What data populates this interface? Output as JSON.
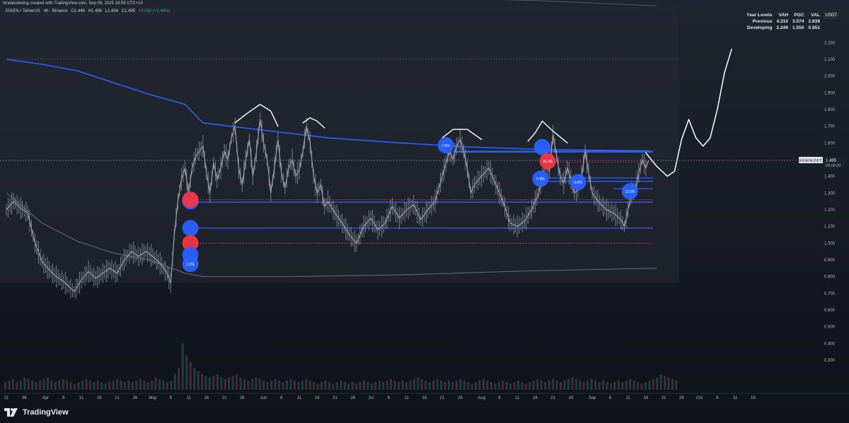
{
  "header": {
    "credit": "timelessbeing created with TradingView.com, Sep 09, 2025 18:59 UTC+10",
    "symbol": "EIGEN / TetherUS · 4h · Binance",
    "ohlc": {
      "open": "O1.446",
      "high": "H1.496",
      "low": "L1.434",
      "close": "C1.495",
      "change": "+0.050 (+3.46%)"
    }
  },
  "currency_button": "USDT",
  "year_levels": {
    "headers": [
      "Year Levels",
      "VAH",
      "POC",
      "VAL"
    ],
    "rows": [
      [
        "Previous",
        "4.310",
        "3.574",
        "2.838"
      ],
      [
        "Developing",
        "2.249",
        "1.550",
        "0.851"
      ]
    ]
  },
  "brand": "TradingView",
  "colors": {
    "background": "#131722",
    "grid": "#2a2e39",
    "vwap": "#2962ff",
    "price": "#b7bac2",
    "buy_marker": "#2962ff",
    "sell_marker": "#f23645"
  },
  "chart_data": {
    "type": "line",
    "symbol": "EIGENUSDT",
    "timeframe": "4h",
    "y_scale": "linear",
    "ylim": [
      0.25,
      2.25
    ],
    "y_ticks": [
      "2.200",
      "2.100",
      "2.000",
      "1.900",
      "1.800",
      "1.700",
      "1.600",
      "1.500",
      "1.400",
      "1.300",
      "1.200",
      "1.100",
      "1.000",
      "0.900",
      "0.800",
      "0.700",
      "0.600",
      "0.500",
      "0.400",
      "0.300"
    ],
    "y_tick_values": [
      2.2,
      2.1,
      2.0,
      1.9,
      1.8,
      1.7,
      1.6,
      1.5,
      1.4,
      1.3,
      1.2,
      1.1,
      1.0,
      0.9,
      0.8,
      0.7,
      0.6,
      0.5,
      0.4,
      0.3
    ],
    "xlim": [
      0,
      234
    ],
    "x_ticks": [
      {
        "label": "21",
        "d": 0
      },
      {
        "label": "26",
        "d": 5
      },
      {
        "label": "Apr",
        "d": 11
      },
      {
        "label": "6",
        "d": 16
      },
      {
        "label": "11",
        "d": 21
      },
      {
        "label": "16",
        "d": 26
      },
      {
        "label": "21",
        "d": 31
      },
      {
        "label": "26",
        "d": 36
      },
      {
        "label": "May",
        "d": 41
      },
      {
        "label": "6",
        "d": 46
      },
      {
        "label": "11",
        "d": 51
      },
      {
        "label": "16",
        "d": 56
      },
      {
        "label": "21",
        "d": 61
      },
      {
        "label": "26",
        "d": 66
      },
      {
        "label": "Jun",
        "d": 72
      },
      {
        "label": "6",
        "d": 77
      },
      {
        "label": "11",
        "d": 82
      },
      {
        "label": "16",
        "d": 87
      },
      {
        "label": "21",
        "d": 92
      },
      {
        "label": "26",
        "d": 97
      },
      {
        "label": "Jul",
        "d": 102
      },
      {
        "label": "6",
        "d": 107
      },
      {
        "label": "11",
        "d": 112
      },
      {
        "label": "16",
        "d": 117
      },
      {
        "label": "21",
        "d": 122
      },
      {
        "label": "26",
        "d": 127
      },
      {
        "label": "Aug",
        "d": 133
      },
      {
        "label": "6",
        "d": 138
      },
      {
        "label": "11",
        "d": 143
      },
      {
        "label": "16",
        "d": 148
      },
      {
        "label": "21",
        "d": 153
      },
      {
        "label": "26",
        "d": 158
      },
      {
        "label": "Sep",
        "d": 164
      },
      {
        "label": "6",
        "d": 169
      },
      {
        "label": "11",
        "d": 174
      },
      {
        "label": "16",
        "d": 179
      },
      {
        "label": "21",
        "d": 184
      },
      {
        "label": "26",
        "d": 189
      },
      {
        "label": "Oct",
        "d": 194
      },
      {
        "label": "6",
        "d": 199
      },
      {
        "label": "11",
        "d": 204
      },
      {
        "label": "16",
        "d": 209
      }
    ],
    "price": {
      "name": "EIGENUSDT",
      "points": [
        [
          0,
          1.2
        ],
        [
          2,
          1.25
        ],
        [
          4,
          1.21
        ],
        [
          6,
          1.18
        ],
        [
          8,
          1.0
        ],
        [
          10,
          0.89
        ],
        [
          12,
          0.84
        ],
        [
          14,
          0.8
        ],
        [
          16,
          0.77
        ],
        [
          18,
          0.73
        ],
        [
          19,
          0.71
        ],
        [
          21,
          0.78
        ],
        [
          23,
          0.83
        ],
        [
          25,
          0.79
        ],
        [
          27,
          0.82
        ],
        [
          29,
          0.85
        ],
        [
          31,
          0.82
        ],
        [
          33,
          0.9
        ],
        [
          35,
          0.95
        ],
        [
          37,
          0.92
        ],
        [
          39,
          0.95
        ],
        [
          41,
          0.92
        ],
        [
          43,
          0.88
        ],
        [
          45,
          0.82
        ],
        [
          46,
          0.76
        ],
        [
          47,
          1.05
        ],
        [
          48,
          1.25
        ],
        [
          49,
          1.38
        ],
        [
          50,
          1.45
        ],
        [
          51,
          1.3
        ],
        [
          52,
          1.45
        ],
        [
          53,
          1.52
        ],
        [
          55,
          1.58
        ],
        [
          56,
          1.42
        ],
        [
          57,
          1.3
        ],
        [
          58,
          1.48
        ],
        [
          59,
          1.38
        ],
        [
          60,
          1.45
        ],
        [
          61,
          1.55
        ],
        [
          62,
          1.5
        ],
        [
          63,
          1.63
        ],
        [
          64,
          1.7
        ],
        [
          65,
          1.45
        ],
        [
          66,
          1.35
        ],
        [
          67,
          1.5
        ],
        [
          68,
          1.62
        ],
        [
          69,
          1.4
        ],
        [
          70,
          1.55
        ],
        [
          71,
          1.74
        ],
        [
          72,
          1.6
        ],
        [
          73,
          1.5
        ],
        [
          74,
          1.3
        ],
        [
          75,
          1.45
        ],
        [
          76,
          1.62
        ],
        [
          77,
          1.42
        ],
        [
          78,
          1.33
        ],
        [
          79,
          1.45
        ],
        [
          80,
          1.5
        ],
        [
          81,
          1.4
        ],
        [
          82,
          1.44
        ],
        [
          83,
          1.55
        ],
        [
          84,
          1.7
        ],
        [
          85,
          1.6
        ],
        [
          86,
          1.4
        ],
        [
          87,
          1.3
        ],
        [
          88,
          1.35
        ],
        [
          89,
          1.22
        ],
        [
          90,
          1.25
        ],
        [
          92,
          1.18
        ],
        [
          94,
          1.12
        ],
        [
          96,
          1.05
        ],
        [
          98,
          1.0
        ],
        [
          100,
          1.1
        ],
        [
          102,
          1.15
        ],
        [
          104,
          1.08
        ],
        [
          106,
          1.12
        ],
        [
          108,
          1.22
        ],
        [
          110,
          1.15
        ],
        [
          112,
          1.2
        ],
        [
          114,
          1.23
        ],
        [
          116,
          1.14
        ],
        [
          118,
          1.2
        ],
        [
          120,
          1.25
        ],
        [
          122,
          1.4
        ],
        [
          124,
          1.55
        ],
        [
          125,
          1.5
        ],
        [
          126,
          1.58
        ],
        [
          127,
          1.62
        ],
        [
          128,
          1.55
        ],
        [
          129,
          1.45
        ],
        [
          130,
          1.3
        ],
        [
          131,
          1.35
        ],
        [
          133,
          1.4
        ],
        [
          135,
          1.45
        ],
        [
          137,
          1.35
        ],
        [
          139,
          1.25
        ],
        [
          141,
          1.12
        ],
        [
          143,
          1.1
        ],
        [
          145,
          1.13
        ],
        [
          147,
          1.2
        ],
        [
          149,
          1.3
        ],
        [
          150,
          1.4
        ],
        [
          151,
          1.48
        ],
        [
          152,
          1.43
        ],
        [
          153,
          1.65
        ],
        [
          154,
          1.52
        ],
        [
          155,
          1.4
        ],
        [
          156,
          1.36
        ],
        [
          157,
          1.45
        ],
        [
          158,
          1.38
        ],
        [
          159,
          1.3
        ],
        [
          160,
          1.32
        ],
        [
          161,
          1.4
        ],
        [
          162,
          1.55
        ],
        [
          163,
          1.42
        ],
        [
          164,
          1.3
        ],
        [
          166,
          1.24
        ],
        [
          168,
          1.2
        ],
        [
          170,
          1.18
        ],
        [
          172,
          1.14
        ],
        [
          173,
          1.1
        ],
        [
          174,
          1.2
        ],
        [
          175,
          1.3
        ],
        [
          176,
          1.32
        ],
        [
          177,
          1.42
        ],
        [
          178,
          1.5
        ],
        [
          179,
          1.45
        ],
        [
          179.7,
          1.495
        ]
      ]
    },
    "vwap_upper_band": {
      "points": [
        [
          0,
          2.55
        ],
        [
          50,
          2.52
        ],
        [
          100,
          2.48
        ],
        [
          150,
          2.45
        ],
        [
          182,
          2.42
        ]
      ]
    },
    "vwap_main": {
      "points": [
        [
          0,
          2.1
        ],
        [
          10,
          2.07
        ],
        [
          20,
          2.03
        ],
        [
          30,
          1.96
        ],
        [
          40,
          1.89
        ],
        [
          50,
          1.83
        ],
        [
          55,
          1.72
        ],
        [
          70,
          1.68
        ],
        [
          90,
          1.63
        ],
        [
          110,
          1.6
        ],
        [
          130,
          1.575
        ],
        [
          150,
          1.56
        ],
        [
          180,
          1.552
        ]
      ]
    },
    "vwap_lower_band": {
      "points": [
        [
          0,
          1.3
        ],
        [
          10,
          1.12
        ],
        [
          20,
          1.01
        ],
        [
          30,
          0.94
        ],
        [
          40,
          0.9
        ],
        [
          50,
          0.82
        ],
        [
          55,
          0.8
        ],
        [
          80,
          0.8
        ],
        [
          110,
          0.81
        ],
        [
          140,
          0.83
        ],
        [
          170,
          0.845
        ],
        [
          182,
          0.85
        ]
      ]
    },
    "horizontal_levels": [
      {
        "name": "resistance-1",
        "y": 1.55,
        "x1": 125,
        "x2": 181,
        "style": "solid"
      },
      {
        "name": "resistance-2",
        "y": 1.545,
        "x1": 125,
        "x2": 181,
        "style": "solid"
      },
      {
        "name": "res-box-top",
        "y": 1.39,
        "x1": 149,
        "x2": 181,
        "style": "solid"
      },
      {
        "name": "res-box-mid",
        "y": 1.37,
        "x1": 149,
        "x2": 181,
        "style": "solid"
      },
      {
        "name": "res-box-low",
        "y": 1.325,
        "x1": 170,
        "x2": 181,
        "style": "solid"
      },
      {
        "name": "support-1",
        "y": 1.245,
        "x1": 51,
        "x2": 181,
        "style": "solid"
      },
      {
        "name": "support-2",
        "y": 1.09,
        "x1": 51,
        "x2": 181,
        "style": "solid"
      },
      {
        "name": "red-dotted-1",
        "y": 1.485,
        "x1": 151,
        "x2": 181,
        "style": "dotted"
      },
      {
        "name": "red-dotted-2",
        "y": 1.26,
        "x1": 51,
        "x2": 181,
        "style": "dotted"
      },
      {
        "name": "red-dotted-3",
        "y": 1.0,
        "x1": 51,
        "x2": 181,
        "style": "dotted"
      },
      {
        "name": "gray-dotted-2100",
        "y": 2.1,
        "x1": 0,
        "x2": 182,
        "style": "dotted"
      }
    ],
    "last_price": {
      "label": "EIGENUSDT",
      "value": "1.495",
      "countdown": "03:00:20",
      "y": 1.495
    },
    "markers": [
      {
        "x": 51.5,
        "y": 1.25,
        "color": "blue",
        "label": ""
      },
      {
        "x": 51.5,
        "y": 1.26,
        "color": "red",
        "label": ""
      },
      {
        "x": 51.5,
        "y": 1.09,
        "color": "blue",
        "label": ""
      },
      {
        "x": 51.5,
        "y": 1.0,
        "color": "red",
        "label": ""
      },
      {
        "x": 51.5,
        "y": 0.93,
        "color": "blue",
        "label": ""
      },
      {
        "x": 51.5,
        "y": 0.875,
        "color": "blue",
        "label": "3.3%"
      },
      {
        "x": 123,
        "y": 1.585,
        "color": "blue",
        "label": "7.6%"
      },
      {
        "x": 150,
        "y": 1.575,
        "color": "blue",
        "label": ""
      },
      {
        "x": 151.5,
        "y": 1.49,
        "color": "red",
        "label": "30.0%"
      },
      {
        "x": 149.5,
        "y": 1.385,
        "color": "blue",
        "label": "5.3%"
      },
      {
        "x": 160,
        "y": 1.365,
        "color": "blue",
        "label": "9.6%"
      },
      {
        "x": 174.5,
        "y": 1.31,
        "color": "blue",
        "label": "12.5%"
      }
    ],
    "sketch_arches": [
      [
        [
          64,
          1.72
        ],
        [
          67,
          1.77
        ],
        [
          71,
          1.83
        ],
        [
          74,
          1.79
        ],
        [
          76,
          1.7
        ]
      ],
      [
        [
          83,
          1.72
        ],
        [
          85,
          1.75
        ],
        [
          87,
          1.73
        ],
        [
          89,
          1.69
        ]
      ],
      [
        [
          122,
          1.63
        ],
        [
          125,
          1.68
        ],
        [
          129,
          1.68
        ],
        [
          133,
          1.62
        ]
      ],
      [
        [
          146,
          1.61
        ],
        [
          148,
          1.66
        ],
        [
          150,
          1.73
        ],
        [
          153,
          1.67
        ],
        [
          157,
          1.6
        ]
      ]
    ],
    "projection_path": [
      [
        179,
        1.54
      ],
      [
        182,
        1.46
      ],
      [
        185,
        1.4
      ],
      [
        187,
        1.43
      ],
      [
        189,
        1.62
      ],
      [
        191,
        1.74
      ],
      [
        193,
        1.63
      ],
      [
        195,
        1.58
      ],
      [
        197,
        1.63
      ],
      [
        199,
        1.8
      ],
      [
        201,
        2.02
      ],
      [
        203,
        2.16
      ]
    ],
    "volume": {
      "name": "Volume",
      "values": [
        0.05,
        0.06,
        0.07,
        0.05,
        0.06,
        0.08,
        0.07,
        0.06,
        0.05,
        0.06,
        0.07,
        0.08,
        0.06,
        0.05,
        0.06,
        0.07,
        0.06,
        0.05,
        0.04,
        0.05,
        0.06,
        0.07,
        0.06,
        0.05,
        0.06,
        0.05,
        0.04,
        0.05,
        0.06,
        0.07,
        0.06,
        0.05,
        0.06,
        0.05,
        0.06,
        0.07,
        0.06,
        0.05,
        0.06,
        0.08,
        0.07,
        0.06,
        0.05,
        0.06,
        0.1,
        0.14,
        0.3,
        0.22,
        0.18,
        0.14,
        0.12,
        0.1,
        0.09,
        0.08,
        0.09,
        0.1,
        0.08,
        0.07,
        0.08,
        0.09,
        0.1,
        0.08,
        0.07,
        0.06,
        0.07,
        0.08,
        0.07,
        0.06,
        0.05,
        0.06,
        0.07,
        0.06,
        0.05,
        0.06,
        0.07,
        0.06,
        0.05,
        0.06,
        0.07,
        0.06,
        0.05,
        0.04,
        0.05,
        0.06,
        0.05,
        0.04,
        0.05,
        0.06,
        0.05,
        0.04,
        0.05,
        0.04,
        0.05,
        0.06,
        0.05,
        0.04,
        0.05,
        0.06,
        0.05,
        0.06,
        0.07,
        0.06,
        0.05,
        0.06,
        0.05,
        0.06,
        0.07,
        0.08,
        0.07,
        0.06,
        0.05,
        0.06,
        0.07,
        0.06,
        0.05,
        0.06,
        0.05,
        0.06,
        0.07,
        0.06,
        0.05,
        0.04,
        0.05,
        0.06,
        0.07,
        0.06,
        0.05,
        0.04,
        0.05,
        0.06,
        0.05,
        0.04,
        0.05,
        0.06,
        0.05,
        0.04,
        0.05,
        0.06,
        0.07,
        0.06,
        0.05,
        0.06,
        0.07,
        0.06,
        0.05,
        0.06,
        0.07,
        0.08,
        0.07,
        0.06,
        0.05,
        0.06,
        0.07,
        0.06,
        0.05,
        0.06,
        0.05,
        0.04,
        0.05,
        0.06,
        0.05,
        0.06,
        0.07,
        0.06,
        0.05,
        0.04,
        0.05,
        0.06,
        0.07,
        0.08,
        0.1,
        0.09,
        0.08,
        0.07,
        0.06
      ]
    },
    "grid": false,
    "legend": "none"
  }
}
